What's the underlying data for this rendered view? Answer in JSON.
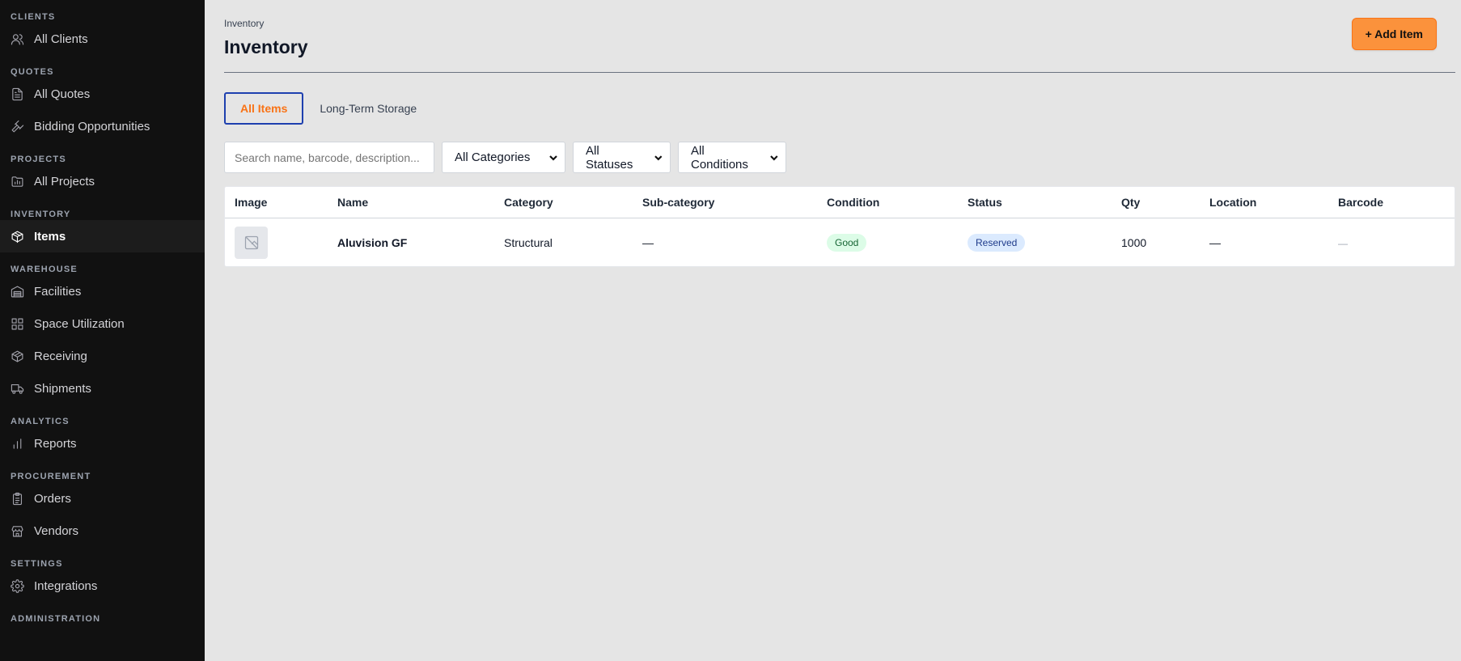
{
  "sidebar": {
    "sections": [
      {
        "label": "CLIENTS",
        "items": [
          {
            "label": "All Clients",
            "icon": "users-icon"
          }
        ]
      },
      {
        "label": "QUOTES",
        "items": [
          {
            "label": "All Quotes",
            "icon": "document-icon"
          },
          {
            "label": "Bidding Opportunities",
            "icon": "gavel-icon"
          }
        ]
      },
      {
        "label": "PROJECTS",
        "items": [
          {
            "label": "All Projects",
            "icon": "folder-chart-icon"
          }
        ]
      },
      {
        "label": "INVENTORY",
        "items": [
          {
            "label": "Items",
            "icon": "package-icon"
          }
        ]
      },
      {
        "label": "WAREHOUSE",
        "items": [
          {
            "label": "Facilities",
            "icon": "warehouse-icon"
          },
          {
            "label": "Space Utilization",
            "icon": "grid-icon"
          },
          {
            "label": "Receiving",
            "icon": "box-icon"
          },
          {
            "label": "Shipments",
            "icon": "truck-icon"
          }
        ]
      },
      {
        "label": "ANALYTICS",
        "items": [
          {
            "label": "Reports",
            "icon": "bar-chart-icon"
          }
        ]
      },
      {
        "label": "PROCUREMENT",
        "items": [
          {
            "label": "Orders",
            "icon": "clipboard-icon"
          },
          {
            "label": "Vendors",
            "icon": "store-icon"
          }
        ]
      },
      {
        "label": "SETTINGS",
        "items": [
          {
            "label": "Integrations",
            "icon": "gear-icon"
          }
        ]
      },
      {
        "label": "ADMINISTRATION",
        "items": []
      }
    ],
    "active_item": "Items"
  },
  "header": {
    "breadcrumb": "Inventory",
    "title": "Inventory",
    "add_button": "+ Add Item"
  },
  "tabs": [
    {
      "label": "All Items",
      "active": true
    },
    {
      "label": "Long-Term Storage",
      "active": false
    }
  ],
  "filters": {
    "search_placeholder": "Search name, barcode, description...",
    "category": "All Categories",
    "status": "All Statuses",
    "condition": "All Conditions"
  },
  "table": {
    "columns": [
      "Image",
      "Name",
      "Category",
      "Sub-category",
      "Condition",
      "Status",
      "Qty",
      "Location",
      "Barcode"
    ],
    "rows": [
      {
        "image": "image-placeholder-icon",
        "name": "Aluvision GF",
        "category": "Structural",
        "subcategory": "—",
        "condition": "Good",
        "status": "Reserved",
        "qty": "1000",
        "location": "—",
        "barcode": "—"
      }
    ]
  },
  "colors": {
    "accent": "#fb923c",
    "sidebar_bg": "#111111",
    "active_tab_border": "#1e40af"
  }
}
